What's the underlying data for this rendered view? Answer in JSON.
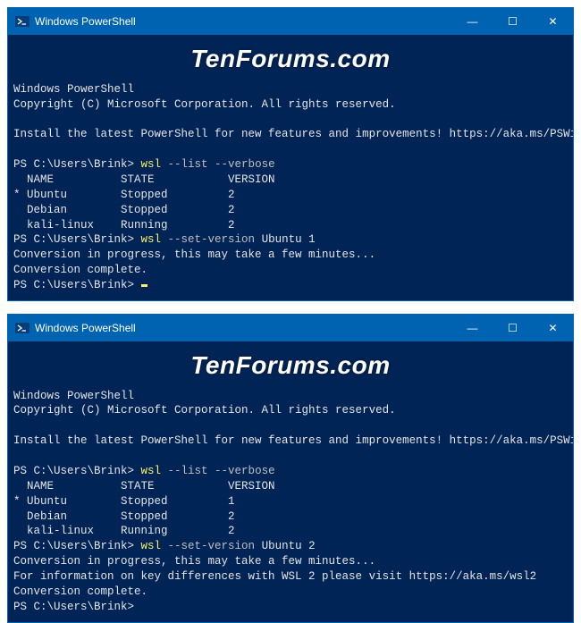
{
  "watermark": "TenForums.com",
  "window1": {
    "title": "Windows PowerShell",
    "controls": {
      "min": "—",
      "max": "☐",
      "close": "✕"
    },
    "lines": [
      {
        "t": "Windows PowerShell"
      },
      {
        "t": "Copyright (C) Microsoft Corporation. All rights reserved."
      },
      {
        "t": " "
      },
      {
        "t": "Install the latest PowerShell for new features and improvements! https://aka.ms/PSWindows"
      },
      {
        "t": " "
      },
      {
        "seg": [
          {
            "t": "PS C:\\Users\\Brink> "
          },
          {
            "t": "wsl ",
            "c": "yellow"
          },
          {
            "t": "--list --verbose",
            "c": "gray"
          }
        ]
      },
      {
        "t": "  NAME          STATE           VERSION"
      },
      {
        "t": "* Ubuntu        Stopped         2"
      },
      {
        "t": "  Debian        Stopped         2"
      },
      {
        "t": "  kali-linux    Running         2"
      },
      {
        "seg": [
          {
            "t": "PS C:\\Users\\Brink> "
          },
          {
            "t": "wsl ",
            "c": "yellow"
          },
          {
            "t": "--set-version ",
            "c": "gray"
          },
          {
            "t": "Ubuntu 1"
          }
        ]
      },
      {
        "t": "Conversion in progress, this may take a few minutes..."
      },
      {
        "t": "Conversion complete."
      },
      {
        "seg": [
          {
            "t": "PS C:\\Users\\Brink> "
          },
          {
            "cursor": true
          }
        ]
      }
    ]
  },
  "window2": {
    "title": "Windows PowerShell",
    "controls": {
      "min": "—",
      "max": "☐",
      "close": "✕"
    },
    "lines": [
      {
        "t": "Windows PowerShell"
      },
      {
        "t": "Copyright (C) Microsoft Corporation. All rights reserved."
      },
      {
        "t": " "
      },
      {
        "t": "Install the latest PowerShell for new features and improvements! https://aka.ms/PSWindows"
      },
      {
        "t": " "
      },
      {
        "seg": [
          {
            "t": "PS C:\\Users\\Brink> "
          },
          {
            "t": "wsl ",
            "c": "yellow"
          },
          {
            "t": "--list --verbose",
            "c": "gray"
          }
        ]
      },
      {
        "t": "  NAME          STATE           VERSION"
      },
      {
        "t": "* Ubuntu        Stopped         1"
      },
      {
        "t": "  Debian        Stopped         2"
      },
      {
        "t": "  kali-linux    Running         2"
      },
      {
        "seg": [
          {
            "t": "PS C:\\Users\\Brink> "
          },
          {
            "t": "wsl ",
            "c": "yellow"
          },
          {
            "t": "--set-version ",
            "c": "gray"
          },
          {
            "t": "Ubuntu 2"
          }
        ]
      },
      {
        "t": "Conversion in progress, this may take a few minutes..."
      },
      {
        "t": "For information on key differences with WSL 2 please visit https://aka.ms/wsl2"
      },
      {
        "t": "Conversion complete."
      },
      {
        "seg": [
          {
            "t": "PS C:\\Users\\Brink> "
          }
        ]
      }
    ]
  }
}
